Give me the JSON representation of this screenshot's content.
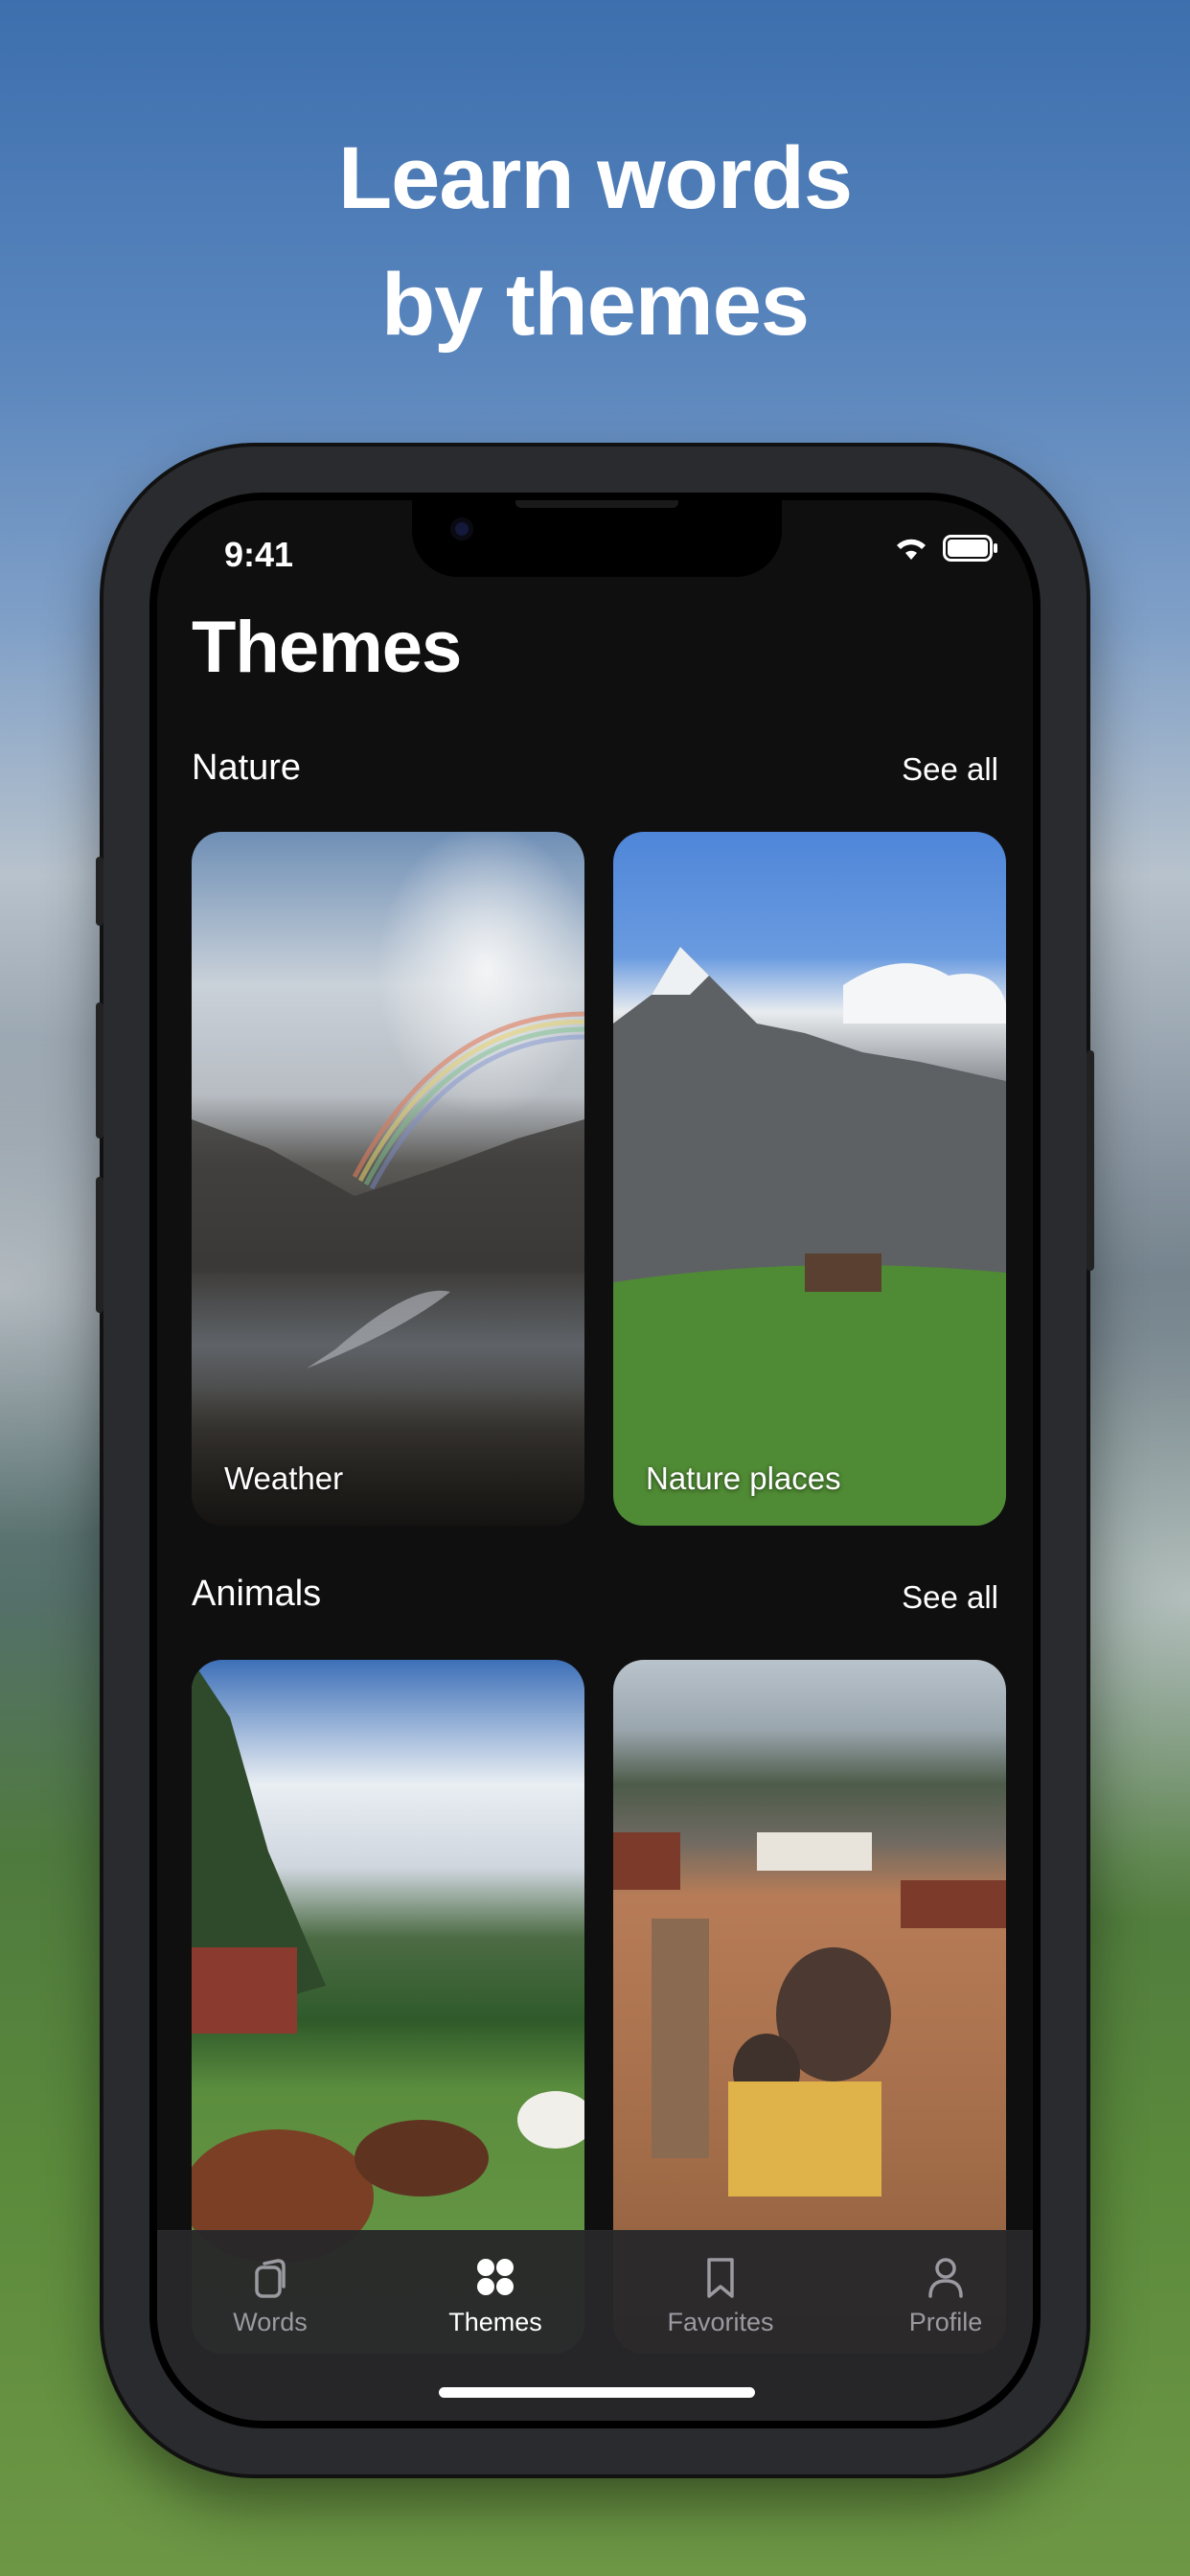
{
  "headline": {
    "line1": "Learn words",
    "line2": "by themes"
  },
  "status_bar": {
    "time": "9:41"
  },
  "page_title": "Themes",
  "sections": [
    {
      "title": "Nature",
      "see_all": "See all",
      "cards": [
        {
          "label": "Weather"
        },
        {
          "label": "Nature places"
        }
      ]
    },
    {
      "title": "Animals",
      "see_all": "See all",
      "cards": [
        {
          "label": ""
        },
        {
          "label": ""
        }
      ]
    }
  ],
  "tab_bar": {
    "active": "Themes",
    "tabs": [
      {
        "label": "Words",
        "icon": "cards-icon"
      },
      {
        "label": "Themes",
        "icon": "grid-dots-icon"
      },
      {
        "label": "Favorites",
        "icon": "bookmark-icon"
      },
      {
        "label": "Profile",
        "icon": "person-icon"
      }
    ]
  },
  "colors": {
    "screen_background": "#0f0f10",
    "tab_active": "#ffffff",
    "tab_inactive": "#9a9aa0"
  }
}
